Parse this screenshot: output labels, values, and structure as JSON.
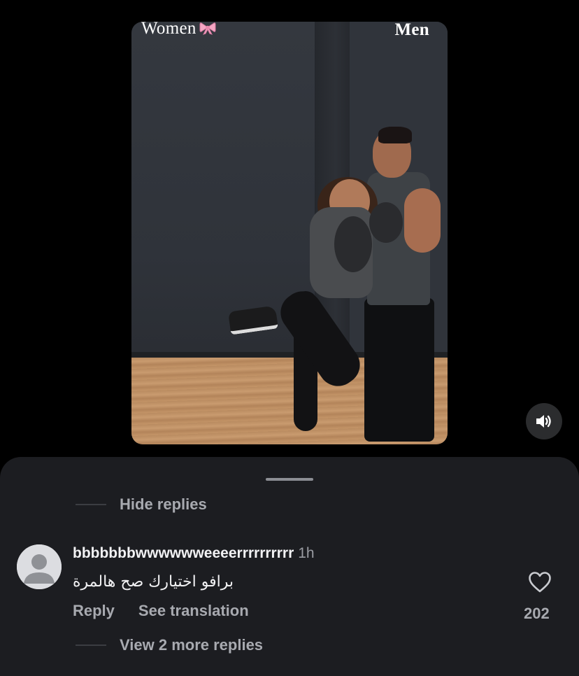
{
  "video": {
    "label_left": "Women",
    "label_right": "Men",
    "bow_icon": "ribbon-bow-icon",
    "mute_icon": "speaker-volume-icon"
  },
  "comments": {
    "hide_replies_label": "Hide replies",
    "reply": {
      "username": "bbbbbbbwwwwwweeeerrrrrrrrrr",
      "time": "1h",
      "text": "برافو اختيارك صح هالمرة",
      "reply_label": "Reply",
      "see_translation_label": "See translation",
      "like_count": "202",
      "like_icon": "heart-outline-icon",
      "avatar_icon": "default-avatar-icon"
    },
    "view_more_label": "View 2 more replies"
  },
  "colors": {
    "background": "#000000",
    "sheet": "#1c1d21",
    "muted_text": "#a8aab0",
    "primary_text": "#f2f2f4"
  }
}
